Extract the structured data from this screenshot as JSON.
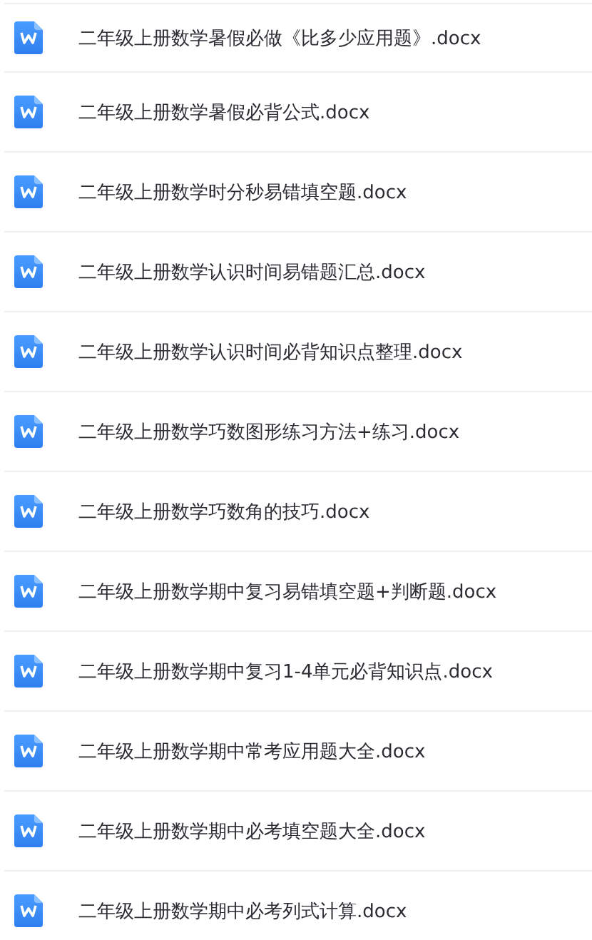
{
  "files": [
    {
      "name": "二年级上册数学暑假必做《比多少应用题》.docx"
    },
    {
      "name": "二年级上册数学暑假必背公式.docx"
    },
    {
      "name": "二年级上册数学时分秒易错填空题.docx"
    },
    {
      "name": "二年级上册数学认识时间易错题汇总.docx"
    },
    {
      "name": "二年级上册数学认识时间必背知识点整理.docx"
    },
    {
      "name": "二年级上册数学巧数图形练习方法+练习.docx"
    },
    {
      "name": "二年级上册数学巧数角的技巧.docx"
    },
    {
      "name": "二年级上册数学期中复习易错填空题+判断题.docx"
    },
    {
      "name": "二年级上册数学期中复习1-4单元必背知识点.docx"
    },
    {
      "name": "二年级上册数学期中常考应用题大全.docx"
    },
    {
      "name": "二年级上册数学期中必考填空题大全.docx"
    },
    {
      "name": "二年级上册数学期中必考列式计算.docx"
    }
  ]
}
